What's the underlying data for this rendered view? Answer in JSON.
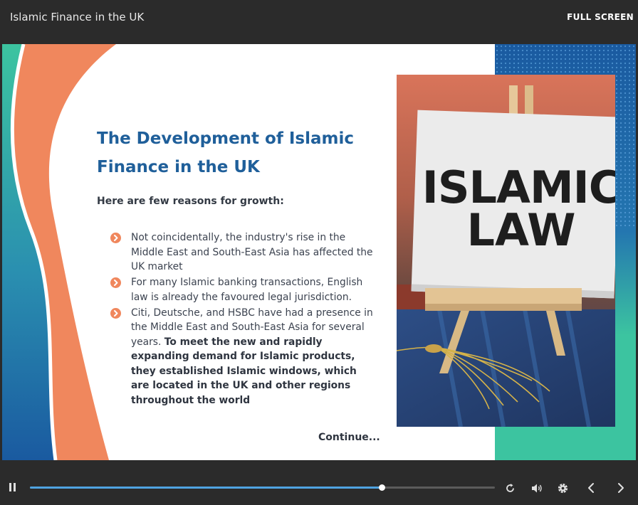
{
  "header": {
    "title": "Islamic Finance in the UK",
    "fullscreen_label": "FULL SCREEN"
  },
  "slide": {
    "title": "The Development of Islamic Finance in the UK",
    "intro": "Here are few reasons for growth:",
    "bullets": [
      {
        "text": "Not coincidentally, the industry's rise in the Middle East and South-East Asia has affected the UK market",
        "bold": ""
      },
      {
        "text": "For many Islamic banking transactions, English law is already the favoured legal jurisdiction.",
        "bold": ""
      },
      {
        "text": "Citi, Deutsche, and HSBC have had a presence in the Middle East and South-East Asia for several years. ",
        "bold": "To meet the new and rapidly expanding demand for Islamic products, they established Islamic windows, which are located in the UK and other regions throughout the world"
      }
    ],
    "continue_label": "Continue...",
    "image": {
      "sign_line1": "ISLAMIC",
      "sign_line2": "LAW"
    }
  },
  "player": {
    "progress": 0.757,
    "icons": [
      "pause-icon",
      "replay-icon",
      "volume-icon",
      "settings-icon",
      "previous-icon",
      "next-icon"
    ]
  },
  "colors": {
    "title_blue": "#1f5f9a",
    "accent_orange": "#f0875d",
    "teal": "#3cc4a0",
    "navy": "#1a5aa0",
    "progress_blue": "#4fa3e0",
    "chrome": "#2b2b2b"
  }
}
